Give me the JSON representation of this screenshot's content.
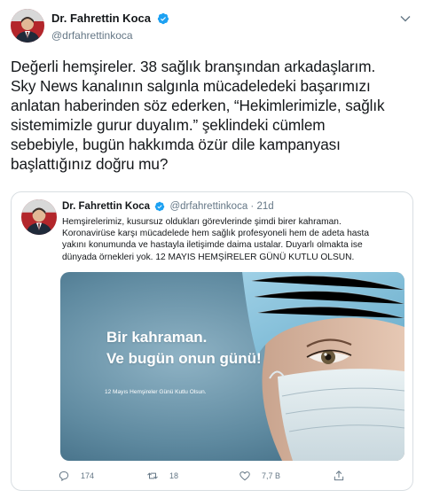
{
  "author": {
    "name": "Dr. Fahrettin Koca",
    "handle": "@drfahrettinkoca"
  },
  "tweet_text": [
    "Değerli hemşireler. 38 sağlık branşından arkadaşlarım.",
    "Sky News kanalının salgınla mücadeledeki başarımızı",
    "anlatan haberinden söz ederken, “Hekimlerimizle, sağlık",
    "sistemimizle gurur duyalım.” şeklindeki cümlem",
    "sebebiyle, bugün hakkımda özür dile kampanyası",
    "başlattığınız doğru mu?"
  ],
  "quoted": {
    "name": "Dr. Fahrettin Koca",
    "handle": "@drfahrettinkoca",
    "dot": "·",
    "time": "21d",
    "text": [
      "Hemşirelerimiz, kusursuz oldukları görevlerinde şimdi birer kahraman.",
      "Koronavirüse karşı mücadelede hem sağlık profesyoneli hem de adeta hasta",
      "yakını konumunda ve hastayla iletişimde daima ustalar. Duyarlı olmakta ise",
      "dünyada örnekleri yok. 12 MAYIS HEMŞİRELER GÜNÜ KUTLU OLSUN."
    ],
    "image": {
      "title_line1": "Bir kahraman.",
      "title_line2": "Ve bugün onun günü!",
      "subtitle": "12 Mayıs Hemşireler Günü Kutlu Olsun."
    }
  },
  "actions": {
    "reply_count": "174",
    "retweet_count": "18",
    "like_count": "7,7 B",
    "icons": [
      "reply-icon",
      "retweet-icon",
      "like-icon",
      "share-icon"
    ]
  },
  "colors": {
    "accent": "#1da1f2",
    "text": "#14171a",
    "muted": "#657786",
    "image_bg": "#5f8aa0"
  }
}
